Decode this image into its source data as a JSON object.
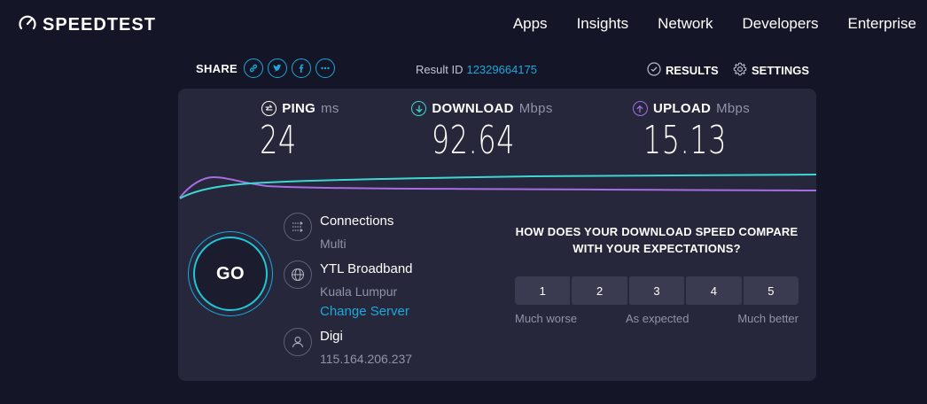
{
  "header": {
    "logo_text": "SPEEDTEST",
    "nav": [
      "Apps",
      "Insights",
      "Network",
      "Developers",
      "Enterprise"
    ]
  },
  "toolbar": {
    "share_label": "SHARE",
    "share_icons": [
      "link-icon",
      "twitter-icon",
      "facebook-icon",
      "more-icon"
    ],
    "result_id_label": "Result ID",
    "result_id_value": "12329664175",
    "results_label": "RESULTS",
    "settings_label": "SETTINGS"
  },
  "metrics": {
    "ping": {
      "label": "PING",
      "unit": "ms",
      "value": "24"
    },
    "download": {
      "label": "DOWNLOAD",
      "unit": "Mbps",
      "value": "92.64"
    },
    "upload": {
      "label": "UPLOAD",
      "unit": "Mbps",
      "value": "15.13"
    }
  },
  "go_label": "GO",
  "connections": {
    "title": "Connections",
    "value": "Multi"
  },
  "server": {
    "title": "YTL Broadband",
    "location": "Kuala Lumpur",
    "change_label": "Change Server"
  },
  "isp": {
    "title": "Digi",
    "ip": "115.164.206.237"
  },
  "survey": {
    "question_line1": "HOW DOES YOUR DOWNLOAD SPEED COMPARE",
    "question_line2": "WITH YOUR EXPECTATIONS?",
    "options": [
      "1",
      "2",
      "3",
      "4",
      "5"
    ],
    "scale_low": "Much worse",
    "scale_mid": "As expected",
    "scale_high": "Much better"
  },
  "colors": {
    "accent": "#1ca8dd",
    "download_line": "#3ed6d2",
    "upload_line": "#a56ee3",
    "background": "#141526",
    "card": "#26273a"
  }
}
